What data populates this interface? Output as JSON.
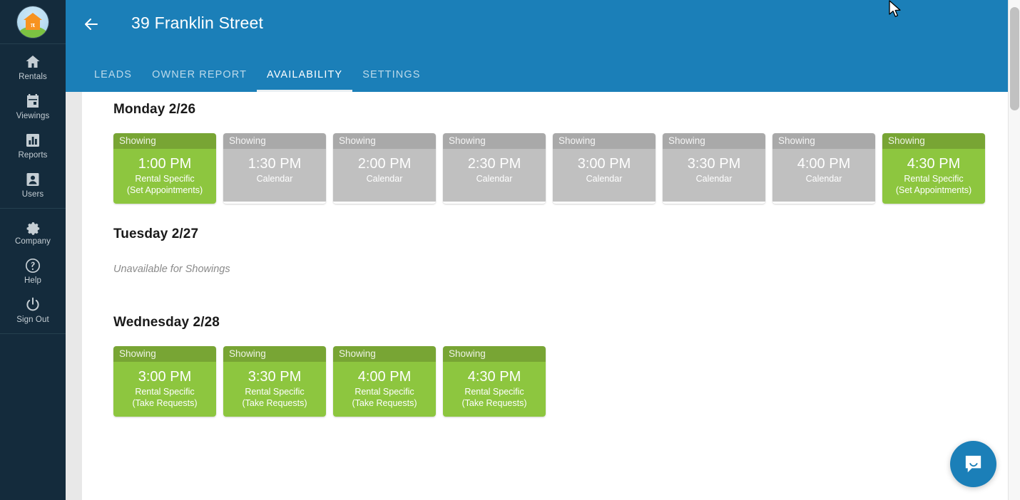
{
  "colors": {
    "sidebar_bg": "#142b3c",
    "header_blue": "#1b7fb8",
    "slot_green": "#8dc63f",
    "slot_green_head": "#78a534",
    "slot_grey": "#c0c0c0",
    "slot_grey_head": "#a9a9a9",
    "content_bg": "#ffffff",
    "gutter": "#e8e8e8"
  },
  "sidebar": {
    "logo_name": "app-logo",
    "groups": [
      {
        "items": [
          {
            "icon": "home-icon",
            "label": "Rentals"
          },
          {
            "icon": "calendar-icon",
            "label": "Viewings"
          },
          {
            "icon": "bar-chart-icon",
            "label": "Reports"
          },
          {
            "icon": "user-icon",
            "label": "Users"
          }
        ]
      },
      {
        "items": [
          {
            "icon": "gear-icon",
            "label": "Company"
          },
          {
            "icon": "question-icon",
            "label": "Help"
          },
          {
            "icon": "power-icon",
            "label": "Sign Out"
          }
        ]
      }
    ]
  },
  "header": {
    "back_label": "Back",
    "title": "39 Franklin Street",
    "tabs": [
      {
        "label": "LEADS",
        "active": false
      },
      {
        "label": "OWNER REPORT",
        "active": false
      },
      {
        "label": "AVAILABILITY",
        "active": true
      },
      {
        "label": "SETTINGS",
        "active": false
      }
    ]
  },
  "availability": {
    "days": [
      {
        "title": "Monday 2/26",
        "unavailable_text": "",
        "slots": [
          {
            "status": "Showing",
            "time": "1:00 PM",
            "type": "Rental Specific",
            "sub": "(Set Appointments)",
            "color": "green"
          },
          {
            "status": "Showing",
            "time": "1:30 PM",
            "type": "Calendar",
            "sub": "",
            "color": "grey"
          },
          {
            "status": "Showing",
            "time": "2:00 PM",
            "type": "Calendar",
            "sub": "",
            "color": "grey"
          },
          {
            "status": "Showing",
            "time": "2:30 PM",
            "type": "Calendar",
            "sub": "",
            "color": "grey"
          },
          {
            "status": "Showing",
            "time": "3:00 PM",
            "type": "Calendar",
            "sub": "",
            "color": "grey"
          },
          {
            "status": "Showing",
            "time": "3:30 PM",
            "type": "Calendar",
            "sub": "",
            "color": "grey"
          },
          {
            "status": "Showing",
            "time": "4:00 PM",
            "type": "Calendar",
            "sub": "",
            "color": "grey"
          },
          {
            "status": "Showing",
            "time": "4:30 PM",
            "type": "Rental Specific",
            "sub": "(Set Appointments)",
            "color": "green"
          }
        ]
      },
      {
        "title": "Tuesday 2/27",
        "unavailable_text": "Unavailable for Showings",
        "slots": []
      },
      {
        "title": "Wednesday 2/28",
        "unavailable_text": "",
        "slots": [
          {
            "status": "Showing",
            "time": "3:00 PM",
            "type": "Rental Specific",
            "sub": "(Take Requests)",
            "color": "green"
          },
          {
            "status": "Showing",
            "time": "3:30 PM",
            "type": "Rental Specific",
            "sub": "(Take Requests)",
            "color": "green"
          },
          {
            "status": "Showing",
            "time": "4:00 PM",
            "type": "Rental Specific",
            "sub": "(Take Requests)",
            "color": "green"
          },
          {
            "status": "Showing",
            "time": "4:30 PM",
            "type": "Rental Specific",
            "sub": "(Take Requests)",
            "color": "green"
          }
        ]
      }
    ]
  },
  "widgets": {
    "chat_icon": "chat-bubble-icon",
    "cursor_icon": "mouse-pointer-icon"
  }
}
